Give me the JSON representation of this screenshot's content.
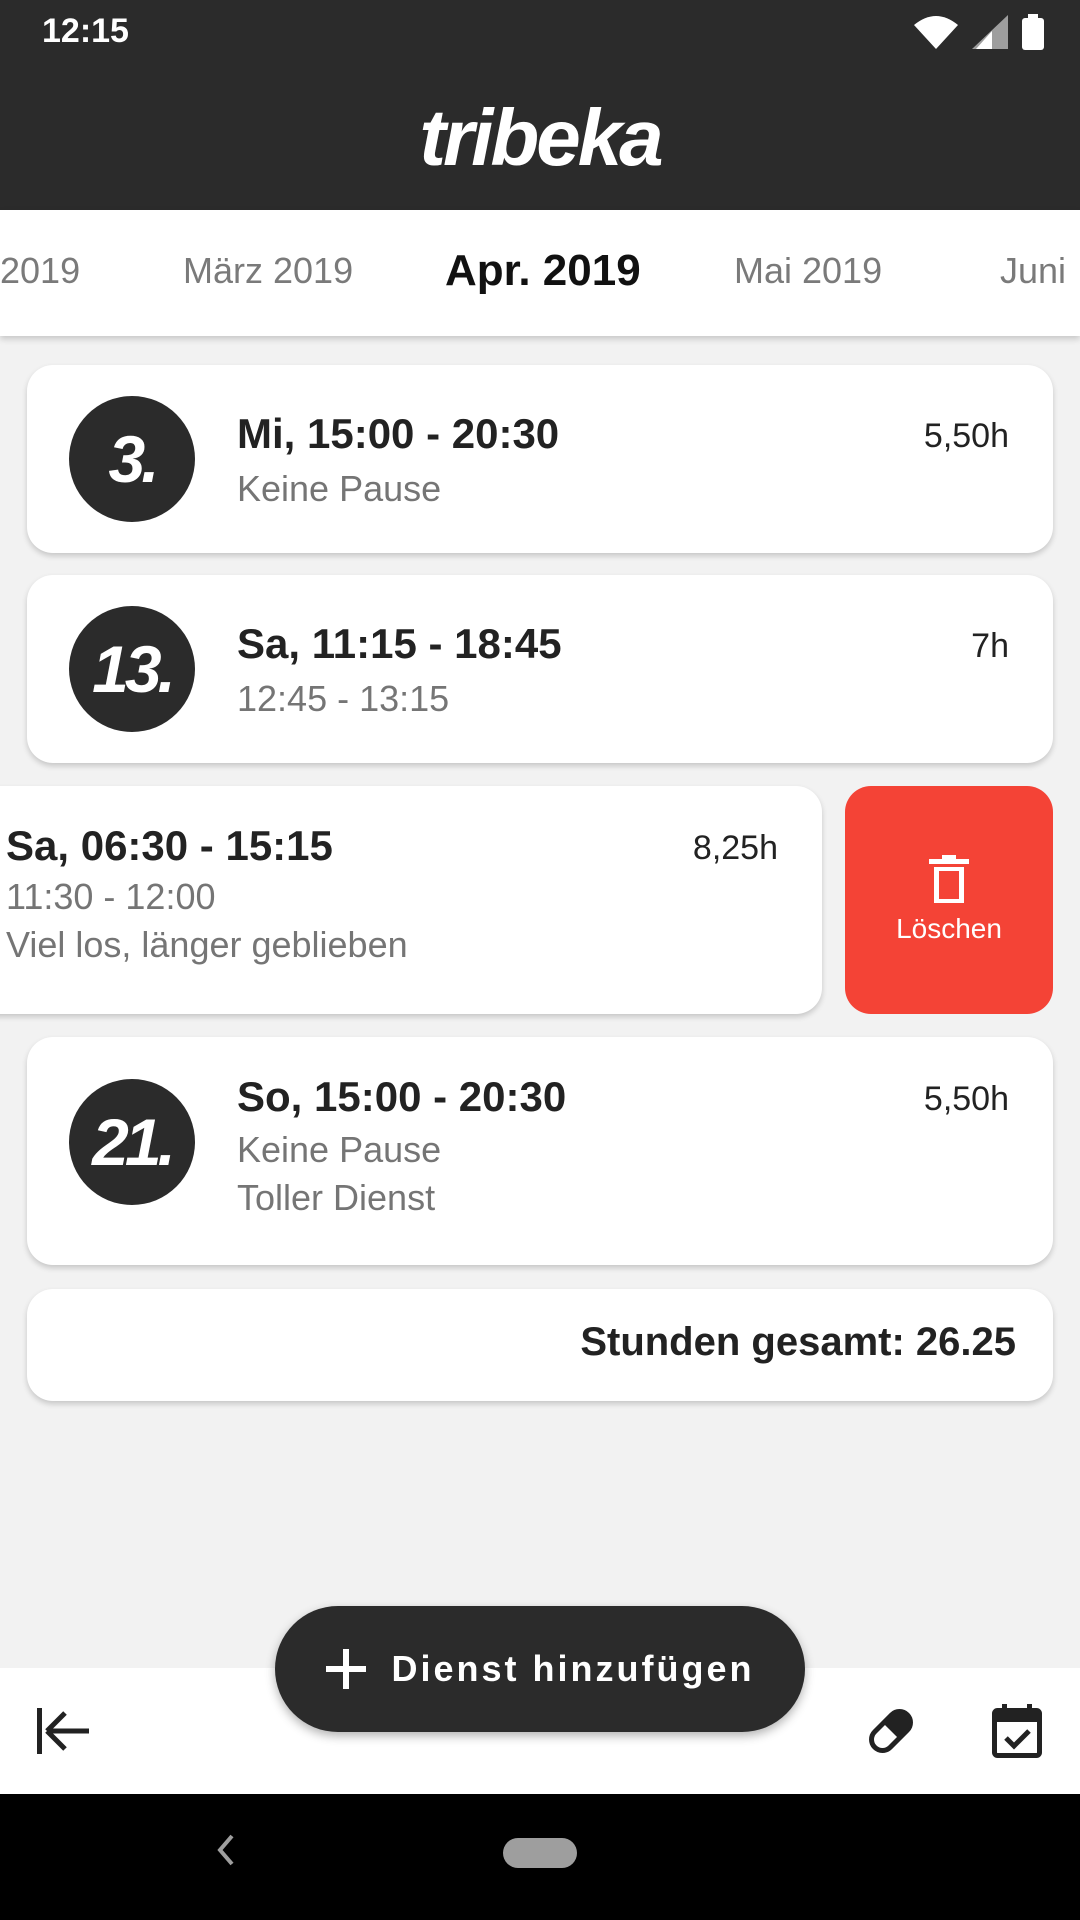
{
  "status": {
    "time": "12:15"
  },
  "app": {
    "logo": "tribeka"
  },
  "months": {
    "items": [
      "2019",
      "März 2019",
      "Apr. 2019",
      "Mai 2019",
      "Juni"
    ],
    "active": "Apr. 2019"
  },
  "shifts": [
    {
      "day": "3.",
      "title": "Mi, 15:00 - 20:30",
      "pause": "Keine Pause",
      "note": "",
      "hours": "5,50h"
    },
    {
      "day": "13.",
      "title": "Sa, 11:15 - 18:45",
      "pause": "12:45 - 13:15",
      "note": "",
      "hours": "7h"
    },
    {
      "day": "",
      "title": "Sa, 06:30 - 15:15",
      "pause": "11:30 - 12:00",
      "note": "Viel los, länger geblieben",
      "hours": "8,25h"
    },
    {
      "day": "21.",
      "title": "So, 15:00 - 20:30",
      "pause": "Keine Pause",
      "note": "Toller Dienst",
      "hours": "5,50h"
    }
  ],
  "delete": {
    "label": "Löschen"
  },
  "total": {
    "label": "Stunden gesamt: 26.25"
  },
  "fab": {
    "label": "Dienst hinzufügen"
  },
  "icons": {
    "wifi": "wifi-icon",
    "signal": "signal-icon",
    "battery": "battery-icon",
    "trash": "trash-icon",
    "plus": "plus-icon",
    "back_to_start": "arrow-left-to-line-icon",
    "sick": "pill-icon",
    "calendar": "calendar-check-icon"
  },
  "colors": {
    "primary": "#2b2b2b",
    "delete": "#f44336",
    "background": "#f2f2f2"
  }
}
